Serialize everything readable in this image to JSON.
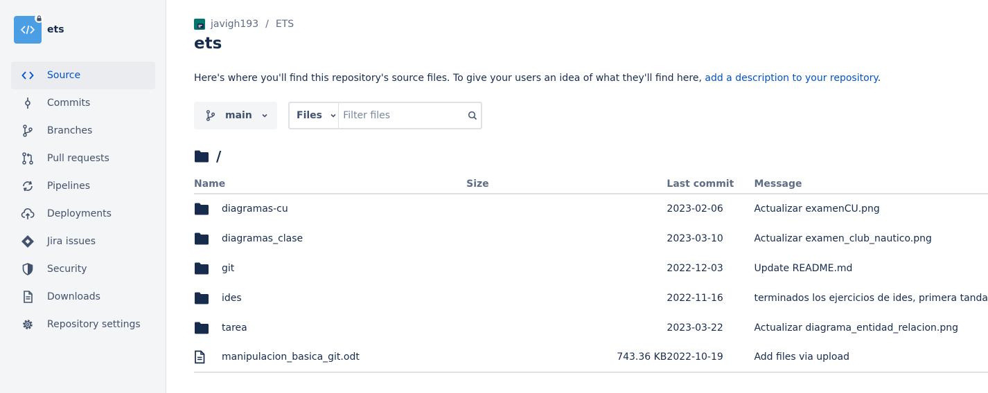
{
  "sidebar": {
    "repo_name": "ets",
    "items": [
      {
        "label": "Source",
        "icon": "code-icon",
        "active": true
      },
      {
        "label": "Commits",
        "icon": "commit-icon",
        "active": false
      },
      {
        "label": "Branches",
        "icon": "branch-icon",
        "active": false
      },
      {
        "label": "Pull requests",
        "icon": "pull-request-icon",
        "active": false
      },
      {
        "label": "Pipelines",
        "icon": "pipelines-icon",
        "active": false
      },
      {
        "label": "Deployments",
        "icon": "cloud-upload-icon",
        "active": false
      },
      {
        "label": "Jira issues",
        "icon": "jira-icon",
        "active": false
      },
      {
        "label": "Security",
        "icon": "shield-icon",
        "active": false
      },
      {
        "label": "Downloads",
        "icon": "document-icon",
        "active": false
      },
      {
        "label": "Repository settings",
        "icon": "gear-icon",
        "active": false
      }
    ]
  },
  "breadcrumb": {
    "workspace": "javigh193",
    "separator": "/",
    "project": "ETS"
  },
  "page": {
    "title": "ets",
    "description_prefix": "Here's where you'll find this repository's source files. To give your users an idea of what they'll find here, ",
    "description_link": "add a description to your repository",
    "description_suffix": "."
  },
  "controls": {
    "branch": "main",
    "files_dropdown": "Files",
    "filter_placeholder": "Filter files"
  },
  "path": "/",
  "table": {
    "headers": {
      "name": "Name",
      "size": "Size",
      "last_commit": "Last commit",
      "message": "Message"
    },
    "rows": [
      {
        "type": "folder",
        "name": "diagramas-cu",
        "size": "",
        "last_commit": "2023-02-06",
        "message": "Actualizar examenCU.png"
      },
      {
        "type": "folder",
        "name": "diagramas_clase",
        "size": "",
        "last_commit": "2023-03-10",
        "message": "Actualizar examen_club_nautico.png"
      },
      {
        "type": "folder",
        "name": "git",
        "size": "",
        "last_commit": "2022-12-03",
        "message": "Update README.md"
      },
      {
        "type": "folder",
        "name": "ides",
        "size": "",
        "last_commit": "2022-11-16",
        "message": "terminados los ejercicios de ides, primera tanda"
      },
      {
        "type": "folder",
        "name": "tarea",
        "size": "",
        "last_commit": "2023-03-22",
        "message": "Actualizar diagrama_entidad_relacion.png"
      },
      {
        "type": "file",
        "name": "manipulacion_basica_git.odt",
        "size": "743.36 KB",
        "last_commit": "2022-10-19",
        "message": "Add files via upload"
      }
    ]
  },
  "colors": {
    "accent": "#0052cc",
    "repo_avatar": "#4c9ee4",
    "text": "#172b4d",
    "sidebar_bg": "#f4f5f7"
  }
}
